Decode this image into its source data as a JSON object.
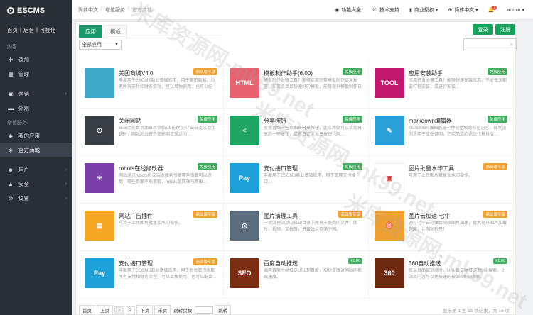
{
  "logo": "ESCMS",
  "sidebar": {
    "topnav": [
      "首页",
      "|",
      "后台",
      "|",
      "可视化"
    ],
    "section_content": "内容",
    "add": "添加",
    "manage": "管理",
    "marketing": "营销",
    "appearance": "外观",
    "section_addon": "增值服务",
    "my_apps": "我的应用",
    "store": "官方商城",
    "users": "用户",
    "security": "安全",
    "settings": "设置"
  },
  "header": {
    "crumbs": [
      "简体中文",
      "增值服务",
      "官方商城"
    ],
    "nav": [
      "功能大全",
      "技术支持",
      "商业授权",
      "简体中文",
      "admin"
    ],
    "badge": "1"
  },
  "tabs": [
    "应用",
    "模板"
  ],
  "buttons": {
    "login": "登录",
    "register": "注册"
  },
  "filter": "全部应用",
  "search_icon": "search-icon",
  "apps": [
    {
      "name": "美团商城V4.0",
      "desc": "丰度用于ESCMS商业基础应用，用于美团商城，后者所有支付和财务流程，可以单独使用，也可以配合…",
      "tag": "商业版专享",
      "pay": true,
      "color": "#3fa9c9",
      "thumb": ""
    },
    {
      "name": "模板制作助手(6.00)",
      "desc": "模板制作必备工具！能够实现完整模板制作定义标签，实现灵活且快速好的模板，能够提升模板制作自己制作…",
      "tag": "免费应用",
      "pay": false,
      "color": "#e8626f",
      "thumb": "HTML"
    },
    {
      "name": "应用安装助手",
      "desc": "应用开发必备工具！能够快速安装应用，不必每次都要打包安装，或进行安装…",
      "tag": "免费应用",
      "pay": false,
      "color": "#c2186b",
      "thumb": "TOOL"
    },
    {
      "name": "关闭网站",
      "desc": "当站点前台页面显示\"网站正在建设中\"或自定义提示语时，网站后台将不受影响正常访问…",
      "tag": "免费应用",
      "pay": false,
      "color": "#3a3f45",
      "thumb": "⏻"
    },
    {
      "name": "分享按钮",
      "desc": "常常看到一些页面有分享按钮，此应用就可以实现分享的一些按钮，或者自定义分享按钮代码…",
      "tag": "免费应用",
      "pay": false,
      "color": "#1fa463",
      "thumb": "<"
    },
    {
      "name": "markdown编辑器",
      "desc": "Markdown 编辑器是一种轻量级的标记语言，最常见的是用于文档说明，它用简洁的语法代替排版…",
      "tag": "免费应用",
      "pay": false,
      "color": "#2a9fd8",
      "thumb": "✎"
    },
    {
      "name": "robots在线修改器",
      "desc": "网站通过robots协议告诉搜索引擎哪些页面可以抓取，哪些页面不能抓取，robots是网站与爬虫…",
      "tag": "免费应用",
      "pay": false,
      "color": "#7a3fa8",
      "thumb": "✳"
    },
    {
      "name": "支付接口管理",
      "desc": "丰度用于ESCMS商业基础应用，用于管理支付接口…",
      "tag": "免费应用",
      "pay": false,
      "color": "#1ea0d8",
      "thumb": "Pay"
    },
    {
      "name": "图片批量水印工具",
      "desc": "可用于上传图片批量加水印操作。",
      "tag": "商业版专享",
      "pay": true,
      "color": "#ffffff",
      "thumb": "▣"
    },
    {
      "name": "网站广告插件",
      "desc": "可用于上传图片批量加水印操作。",
      "tag": "商业版专享",
      "pay": true,
      "color": "#f5a623",
      "thumb": "▤"
    },
    {
      "name": "图片清理工具",
      "desc": "一键清理站点upload目录下所有未使用的文件：图片、视频、文档等，节省站点存储空间。",
      "tag": "商业版专享",
      "pay": true,
      "color": "#5b6c7d",
      "thumb": "◎"
    },
    {
      "name": "图片云加速-七牛",
      "desc": "通过七牛云存储给网站图片加速，极大提升图片加载速度，让网站秒开！",
      "tag": "商业版专享",
      "pay": true,
      "color": "#f0a030",
      "thumb": "♉"
    },
    {
      "name": "支付接口管理",
      "desc": "丰度用于ESCMS商业基础应用，用于后台管理系统所有支付和财务流程，可以单独使用，也可以配合…",
      "tag": "商业版专享",
      "pay": true,
      "color": "#1ea0d8",
      "thumb": "Pay"
    },
    {
      "name": "百度自动推送",
      "desc": "调用百度主动推送URL到百度，加快百度对网站的抓取速度。",
      "tag": "¥1.00",
      "pay": true,
      "color": "#7a2e14",
      "thumb": "SEO"
    },
    {
      "name": "360自动推送",
      "desc": "每当页面被浏览时，URL会自动推送到360搜索，让站点内容可以更快速的被360发现收录。",
      "tag": "¥1.00",
      "pay": true,
      "color": "#6e2a10",
      "thumb": "360"
    }
  ],
  "pager": {
    "first": "首页",
    "prev": "上页",
    "p1": "1",
    "p2": "2",
    "next": "下页",
    "last": "末页",
    "jump_label": "跳转页数",
    "go": "跳转",
    "info": "显示第 1 至 15 项结果，共 16 项"
  },
  "watermark": "米库资源网-mk99.net"
}
